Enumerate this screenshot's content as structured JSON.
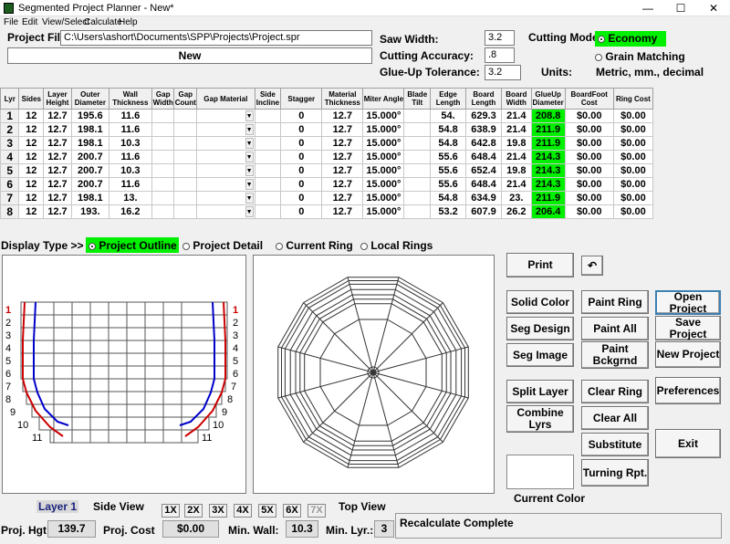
{
  "window": {
    "title": "Segmented Project Planner - New*",
    "min": "—",
    "max": "☐",
    "close": "✕"
  },
  "menu": [
    "File",
    "Edit",
    "View/Select",
    "Calculate",
    "Help"
  ],
  "project": {
    "file_label": "Project File",
    "file_path": "C:\\Users\\ashort\\Documents\\SPP\\Projects\\Project.spr",
    "name": "New"
  },
  "settings": {
    "saw_width_label": "Saw Width:",
    "saw_width": "3.2",
    "cutting_accuracy_label": "Cutting Accuracy:",
    "cutting_accuracy": ".8",
    "glueup_label": "Glue-Up Tolerance:",
    "glueup": "3.2",
    "cutting_mode_label": "Cutting Mode",
    "mode_economy": "Economy",
    "mode_grain": "Grain Matching",
    "units_label": "Units:",
    "units_value": "Metric, mm., decimal"
  },
  "table": {
    "headers": [
      "Lyr",
      "Sides",
      "Layer Height",
      "Outer Diameter",
      "Wall Thickness",
      "Gap Width",
      "Gap Count",
      "Gap Material",
      "Side Incline",
      "Stagger",
      "Material Thickness",
      "Miter Angle",
      "Blade Tilt",
      "Edge Length",
      "Board Length",
      "Board Width",
      "GlueUp Diameter",
      "BoardFoot Cost",
      "Ring Cost"
    ],
    "rows": [
      [
        "1",
        "12",
        "12.7",
        "195.6",
        "11.6",
        "",
        "",
        "",
        "",
        "0",
        "12.7",
        "15.000°",
        "",
        "54.",
        "629.3",
        "21.4",
        "208.8",
        "$0.00",
        "$0.00"
      ],
      [
        "2",
        "12",
        "12.7",
        "198.1",
        "11.6",
        "",
        "",
        "",
        "",
        "0",
        "12.7",
        "15.000°",
        "",
        "54.8",
        "638.9",
        "21.4",
        "211.9",
        "$0.00",
        "$0.00"
      ],
      [
        "3",
        "12",
        "12.7",
        "198.1",
        "10.3",
        "",
        "",
        "",
        "",
        "0",
        "12.7",
        "15.000°",
        "",
        "54.8",
        "642.8",
        "19.8",
        "211.9",
        "$0.00",
        "$0.00"
      ],
      [
        "4",
        "12",
        "12.7",
        "200.7",
        "11.6",
        "",
        "",
        "",
        "",
        "0",
        "12.7",
        "15.000°",
        "",
        "55.6",
        "648.4",
        "21.4",
        "214.3",
        "$0.00",
        "$0.00"
      ],
      [
        "5",
        "12",
        "12.7",
        "200.7",
        "10.3",
        "",
        "",
        "",
        "",
        "0",
        "12.7",
        "15.000°",
        "",
        "55.6",
        "652.4",
        "19.8",
        "214.3",
        "$0.00",
        "$0.00"
      ],
      [
        "6",
        "12",
        "12.7",
        "200.7",
        "11.6",
        "",
        "",
        "",
        "",
        "0",
        "12.7",
        "15.000°",
        "",
        "55.6",
        "648.4",
        "21.4",
        "214.3",
        "$0.00",
        "$0.00"
      ],
      [
        "7",
        "12",
        "12.7",
        "198.1",
        "13.",
        "",
        "",
        "",
        "",
        "0",
        "12.7",
        "15.000°",
        "",
        "54.8",
        "634.9",
        "23.",
        "211.9",
        "$0.00",
        "$0.00"
      ],
      [
        "8",
        "12",
        "12.7",
        "193.",
        "16.2",
        "",
        "",
        "",
        "",
        "0",
        "12.7",
        "15.000°",
        "",
        "53.2",
        "607.9",
        "26.2",
        "206.4",
        "$0.00",
        "$0.00"
      ]
    ]
  },
  "display": {
    "label": "Display Type >>",
    "options": [
      "Project Outline",
      "Project Detail",
      "Current Ring",
      "Local Rings"
    ]
  },
  "side_view": {
    "layer_numbers": [
      "1",
      "2",
      "3",
      "4",
      "5",
      "6",
      "7",
      "8",
      "9",
      "10",
      "11"
    ]
  },
  "buttons": {
    "print": "Print",
    "undo": "↶",
    "solid_color": "Solid Color",
    "seg_design": "Seg Design",
    "seg_image": "Seg Image",
    "paint_ring": "Paint Ring",
    "paint_all": "Paint All",
    "paint_bckgrnd": "Paint Bckgrnd",
    "open_project": "Open Project",
    "save_project": "Save Project",
    "new_project": "New Project",
    "split_layer": "Split Layer",
    "combine_lyrs": "Combine Lyrs",
    "clear_ring": "Clear Ring",
    "clear_all": "Clear All",
    "substitute": "Substitute",
    "turning_rpt": "Turning Rpt.",
    "preferences": "Preferences",
    "exit": "Exit"
  },
  "bottom": {
    "layer": "Layer 1",
    "side_view": "Side View",
    "top_view": "Top View",
    "current_color": "Current Color",
    "zoom": [
      "1X",
      "2X",
      "3X",
      "4X",
      "5X",
      "6X",
      "7X"
    ],
    "proj_hgt_label": "Proj. Hgt",
    "proj_hgt": "139.7",
    "proj_cost_label": "Proj. Cost",
    "proj_cost": "$0.00",
    "min_wall_label": "Min. Wall:",
    "min_wall": "10.3",
    "min_lyr_label": "Min. Lyr.:",
    "min_lyr": "3",
    "status": "Recalculate Complete"
  },
  "colors": {
    "highlight": "#00f000",
    "outer_profile": "#cc0000",
    "inner_profile": "#0000cc"
  }
}
